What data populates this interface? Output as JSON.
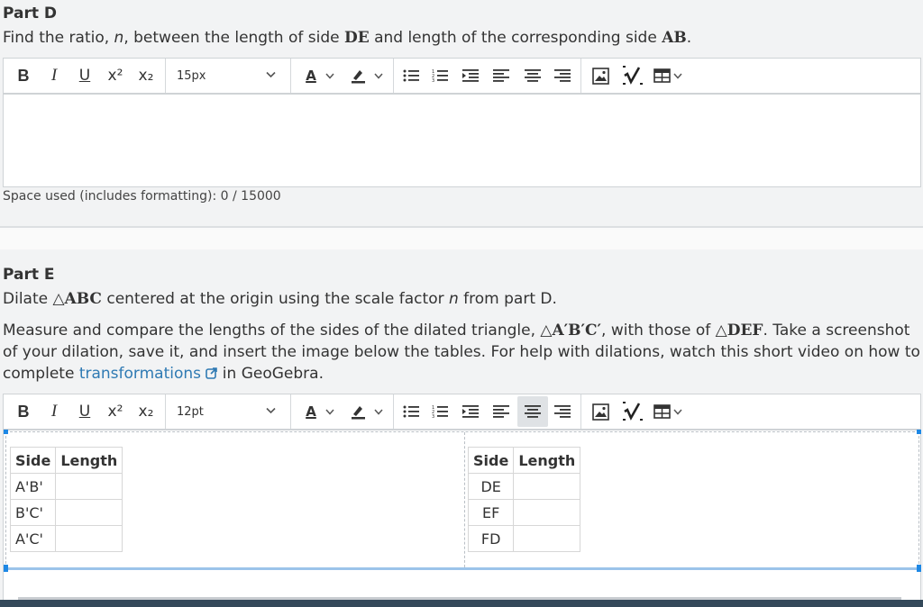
{
  "partD": {
    "title": "Part D",
    "q_pre": "Find the ratio, ",
    "q_var": "n",
    "q_mid": ", between the length of side ",
    "q_side1": "DE",
    "q_mid2": " and length of the corresponding side ",
    "q_side2": "AB",
    "q_end": ".",
    "font_size": "15px",
    "counter": "Space used (includes formatting): 0 / 15000"
  },
  "partE": {
    "title": "Part E",
    "line1_pre": "Dilate ",
    "line1_tri": "△ABC",
    "line1_mid": " centered at the origin using the scale factor ",
    "line1_var": "n",
    "line1_end": " from part D.",
    "p2_a": "Measure and compare the lengths of the sides of the dilated triangle, ",
    "p2_tri1": "△A′B′C′",
    "p2_b": ", with those of ",
    "p2_tri2": "△DEF",
    "p2_c": ". Take a screenshot of your dilation, save it, and insert the image below the tables. For help with dilations, watch this short video on how to complete ",
    "p2_link": "transformations",
    "p2_d": " in GeoGebra.",
    "font_size": "12pt",
    "table1": {
      "headers": [
        "Side",
        "Length"
      ],
      "rows": [
        [
          "A'B'",
          ""
        ],
        [
          "B'C'",
          ""
        ],
        [
          "A'C'",
          ""
        ]
      ]
    },
    "table2": {
      "headers": [
        "Side",
        "Length"
      ],
      "rows": [
        [
          "DE",
          ""
        ],
        [
          "EF",
          ""
        ],
        [
          "FD",
          ""
        ]
      ]
    }
  },
  "toolbar": {
    "bold": "B",
    "italic": "I",
    "underline": "U",
    "superscript": "x²",
    "subscript": "x₂",
    "font_color": "A"
  },
  "icons": [
    "chevron-down-icon",
    "highlighter-icon",
    "bullet-list-icon",
    "numbered-list-icon",
    "indent-icon",
    "align-left-icon",
    "align-center-icon",
    "align-right-icon",
    "image-icon",
    "math-icon",
    "table-icon",
    "external-link-icon"
  ],
  "colors": {
    "link": "#2f7ab3",
    "accent": "#1e88e5"
  }
}
